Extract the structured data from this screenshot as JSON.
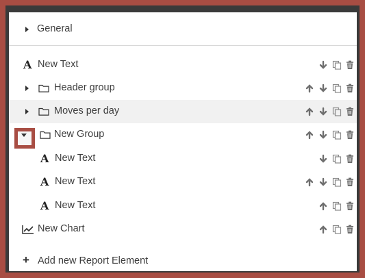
{
  "general": {
    "label": "General"
  },
  "tree": [
    {
      "label": "New Text"
    },
    {
      "label": "Header group"
    },
    {
      "label": "Moves per day"
    },
    {
      "label": "New Group"
    },
    {
      "label": "New Text"
    },
    {
      "label": "New Text"
    },
    {
      "label": "New Text"
    },
    {
      "label": "New Chart"
    }
  ],
  "add": {
    "label": "Add new Report Element"
  },
  "colors": {
    "accent": "#a84d43",
    "icon": "#7a7a7a",
    "row_highlight": "#f1f1f1"
  }
}
